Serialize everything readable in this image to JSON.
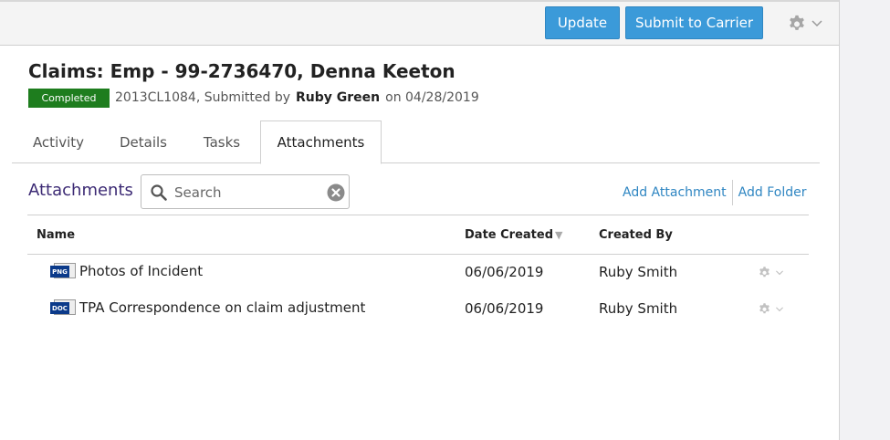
{
  "toolbar": {
    "update_label": "Update",
    "submit_label": "Submit to Carrier",
    "settings_icon": "gear-icon"
  },
  "header": {
    "title": "Claims: Emp - 99-2736470, Denna Keeton",
    "status_badge": "Completed",
    "claim_number": "2013CL1084, Submitted by",
    "submitted_by": "Ruby Green",
    "submitted_on": "on 04/28/2019"
  },
  "tabs": [
    {
      "label": "Activity"
    },
    {
      "label": "Details"
    },
    {
      "label": "Tasks"
    },
    {
      "label": "Attachments",
      "active": true
    }
  ],
  "attachments": {
    "section_title": "Attachments",
    "search_placeholder": "Search",
    "add_attachment": "Add Attachment",
    "add_folder": "Add Folder",
    "columns": {
      "name": "Name",
      "date_created": "Date Created",
      "created_by": "Created By"
    },
    "rows": [
      {
        "filetype": "PNG",
        "name": "Photos of Incident",
        "date": "06/06/2019",
        "created_by": "Ruby Smith"
      },
      {
        "filetype": "DOC",
        "name": "TPA Correspondence on claim adjustment",
        "date": "06/06/2019",
        "created_by": "Ruby Smith"
      }
    ]
  },
  "colors": {
    "primary_button": "#3b9ad9",
    "badge_completed": "#1e7d1e",
    "section_title": "#3c2a74",
    "link": "#2f86c2"
  }
}
